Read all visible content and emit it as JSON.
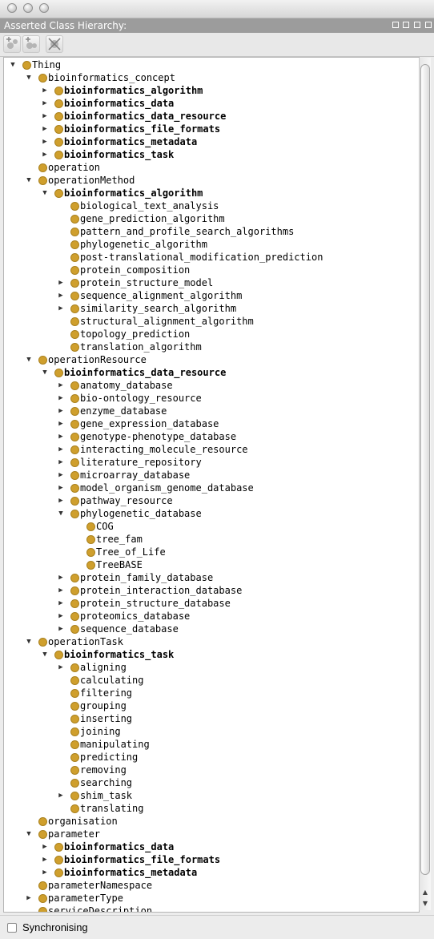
{
  "panel": {
    "title": "Asserted Class Hierarchy:",
    "toolbar_icons": [
      "add-subclass-icon",
      "add-sibling-icon",
      "delete-class-icon"
    ]
  },
  "tree": [
    {
      "label": "Thing",
      "depth": 0,
      "toggle": "open",
      "bold": false
    },
    {
      "label": "bioinformatics_concept",
      "depth": 1,
      "toggle": "open",
      "bold": false
    },
    {
      "label": "bioinformatics_algorithm",
      "depth": 2,
      "toggle": "closed",
      "bold": true
    },
    {
      "label": "bioinformatics_data",
      "depth": 2,
      "toggle": "closed",
      "bold": true
    },
    {
      "label": "bioinformatics_data_resource",
      "depth": 2,
      "toggle": "closed",
      "bold": true
    },
    {
      "label": "bioinformatics_file_formats",
      "depth": 2,
      "toggle": "closed",
      "bold": true
    },
    {
      "label": "bioinformatics_metadata",
      "depth": 2,
      "toggle": "closed",
      "bold": true
    },
    {
      "label": "bioinformatics_task",
      "depth": 2,
      "toggle": "closed",
      "bold": true
    },
    {
      "label": "operation",
      "depth": 1,
      "toggle": "none",
      "bold": false
    },
    {
      "label": "operationMethod",
      "depth": 1,
      "toggle": "open",
      "bold": false
    },
    {
      "label": "bioinformatics_algorithm",
      "depth": 2,
      "toggle": "open",
      "bold": true
    },
    {
      "label": "biological_text_analysis",
      "depth": 3,
      "toggle": "none",
      "bold": false
    },
    {
      "label": "gene_prediction_algorithm",
      "depth": 3,
      "toggle": "none",
      "bold": false
    },
    {
      "label": "pattern_and_profile_search_algorithms",
      "depth": 3,
      "toggle": "none",
      "bold": false
    },
    {
      "label": "phylogenetic_algorithm",
      "depth": 3,
      "toggle": "none",
      "bold": false
    },
    {
      "label": "post-translational_modification_prediction",
      "depth": 3,
      "toggle": "none",
      "bold": false
    },
    {
      "label": "protein_composition",
      "depth": 3,
      "toggle": "none",
      "bold": false
    },
    {
      "label": "protein_structure_model",
      "depth": 3,
      "toggle": "closed",
      "bold": false
    },
    {
      "label": "sequence_alignment_algorithm",
      "depth": 3,
      "toggle": "closed",
      "bold": false
    },
    {
      "label": "similarity_search_algorithm",
      "depth": 3,
      "toggle": "closed",
      "bold": false
    },
    {
      "label": "structural_alignment_algorithm",
      "depth": 3,
      "toggle": "none",
      "bold": false
    },
    {
      "label": "topology_prediction",
      "depth": 3,
      "toggle": "none",
      "bold": false
    },
    {
      "label": "translation_algorithm",
      "depth": 3,
      "toggle": "none",
      "bold": false
    },
    {
      "label": "operationResource",
      "depth": 1,
      "toggle": "open",
      "bold": false
    },
    {
      "label": "bioinformatics_data_resource",
      "depth": 2,
      "toggle": "open",
      "bold": true
    },
    {
      "label": "anatomy_database",
      "depth": 3,
      "toggle": "closed",
      "bold": false
    },
    {
      "label": "bio-ontology_resource",
      "depth": 3,
      "toggle": "closed",
      "bold": false
    },
    {
      "label": "enzyme_database",
      "depth": 3,
      "toggle": "closed",
      "bold": false
    },
    {
      "label": "gene_expression_database",
      "depth": 3,
      "toggle": "closed",
      "bold": false
    },
    {
      "label": "genotype-phenotype_database",
      "depth": 3,
      "toggle": "closed",
      "bold": false
    },
    {
      "label": "interacting_molecule_resource",
      "depth": 3,
      "toggle": "closed",
      "bold": false
    },
    {
      "label": "literature_repository",
      "depth": 3,
      "toggle": "closed",
      "bold": false
    },
    {
      "label": "microarray_database",
      "depth": 3,
      "toggle": "closed",
      "bold": false
    },
    {
      "label": "model_organism_genome_database",
      "depth": 3,
      "toggle": "closed",
      "bold": false
    },
    {
      "label": "pathway_resource",
      "depth": 3,
      "toggle": "closed",
      "bold": false
    },
    {
      "label": "phylogenetic_database",
      "depth": 3,
      "toggle": "open",
      "bold": false
    },
    {
      "label": "COG",
      "depth": 4,
      "toggle": "none",
      "bold": false
    },
    {
      "label": "tree_fam",
      "depth": 4,
      "toggle": "none",
      "bold": false
    },
    {
      "label": "Tree_of_Life",
      "depth": 4,
      "toggle": "none",
      "bold": false
    },
    {
      "label": "TreeBASE",
      "depth": 4,
      "toggle": "none",
      "bold": false
    },
    {
      "label": "protein_family_database",
      "depth": 3,
      "toggle": "closed",
      "bold": false
    },
    {
      "label": "protein_interaction_database",
      "depth": 3,
      "toggle": "closed",
      "bold": false
    },
    {
      "label": "protein_structure_database",
      "depth": 3,
      "toggle": "closed",
      "bold": false
    },
    {
      "label": "proteomics_database",
      "depth": 3,
      "toggle": "closed",
      "bold": false
    },
    {
      "label": "sequence_database",
      "depth": 3,
      "toggle": "closed",
      "bold": false
    },
    {
      "label": "operationTask",
      "depth": 1,
      "toggle": "open",
      "bold": false
    },
    {
      "label": "bioinformatics_task",
      "depth": 2,
      "toggle": "open",
      "bold": true
    },
    {
      "label": "aligning",
      "depth": 3,
      "toggle": "closed",
      "bold": false
    },
    {
      "label": "calculating",
      "depth": 3,
      "toggle": "none",
      "bold": false
    },
    {
      "label": "filtering",
      "depth": 3,
      "toggle": "none",
      "bold": false
    },
    {
      "label": "grouping",
      "depth": 3,
      "toggle": "none",
      "bold": false
    },
    {
      "label": "inserting",
      "depth": 3,
      "toggle": "none",
      "bold": false
    },
    {
      "label": "joining",
      "depth": 3,
      "toggle": "none",
      "bold": false
    },
    {
      "label": "manipulating",
      "depth": 3,
      "toggle": "none",
      "bold": false
    },
    {
      "label": "predicting",
      "depth": 3,
      "toggle": "none",
      "bold": false
    },
    {
      "label": "removing",
      "depth": 3,
      "toggle": "none",
      "bold": false
    },
    {
      "label": "searching",
      "depth": 3,
      "toggle": "none",
      "bold": false
    },
    {
      "label": "shim_task",
      "depth": 3,
      "toggle": "closed",
      "bold": false
    },
    {
      "label": "translating",
      "depth": 3,
      "toggle": "none",
      "bold": false
    },
    {
      "label": "organisation",
      "depth": 1,
      "toggle": "none",
      "bold": false
    },
    {
      "label": "parameter",
      "depth": 1,
      "toggle": "open",
      "bold": false
    },
    {
      "label": "bioinformatics_data",
      "depth": 2,
      "toggle": "closed",
      "bold": true
    },
    {
      "label": "bioinformatics_file_formats",
      "depth": 2,
      "toggle": "closed",
      "bold": true
    },
    {
      "label": "bioinformatics_metadata",
      "depth": 2,
      "toggle": "closed",
      "bold": true
    },
    {
      "label": "parameterNamespace",
      "depth": 1,
      "toggle": "none",
      "bold": false
    },
    {
      "label": "parameterType",
      "depth": 1,
      "toggle": "closed",
      "bold": false
    },
    {
      "label": "serviceDescription",
      "depth": 1,
      "toggle": "none",
      "bold": false
    }
  ],
  "status": {
    "sync_label": "Synchronising",
    "sync_checked": false
  },
  "colors": {
    "class_dot": "#cf9f2d",
    "panel_header_bg": "#9c9c9c"
  }
}
